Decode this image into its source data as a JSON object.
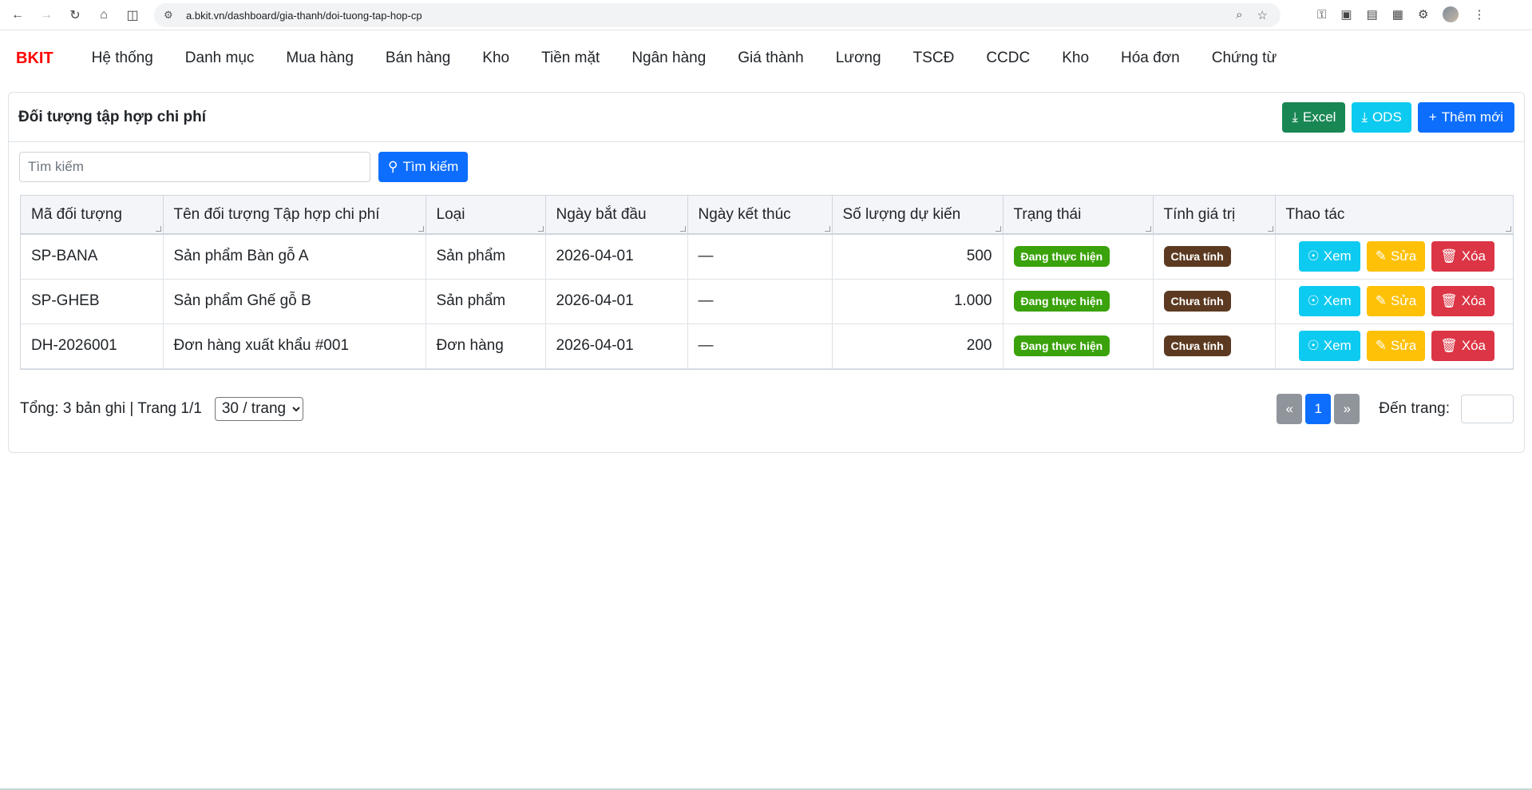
{
  "browser": {
    "url": "a.bkit.vn/dashboard/gia-thanh/doi-tuong-tap-hop-cp"
  },
  "nav": {
    "brand": "BKIT",
    "items": [
      "Hệ thống",
      "Danh mục",
      "Mua hàng",
      "Bán hàng",
      "Kho",
      "Tiền mặt",
      "Ngân hàng",
      "Giá thành",
      "Lương",
      "TSCĐ",
      "CCDC",
      "Kho",
      "Hóa đơn",
      "Chứng từ"
    ]
  },
  "page": {
    "title": "Đối tượng tập hợp chi phí",
    "excel_label": "Excel",
    "ods_label": "ODS",
    "add_label": "Thêm mới",
    "search_placeholder": "Tìm kiếm",
    "search_button": "Tìm kiếm"
  },
  "table": {
    "columns": [
      "Mã đối tượng",
      "Tên đối tượng Tập hợp chi phí",
      "Loại",
      "Ngày bắt đầu",
      "Ngày kết thúc",
      "Số lượng dự kiến",
      "Trạng thái",
      "Tính giá trị",
      "Thao tác"
    ],
    "rows": [
      {
        "code": "SP-BANA",
        "name": "Sản phẩm Bàn gỗ A",
        "type": "Sản phẩm",
        "start": "2026-04-01",
        "end": "—",
        "qty": "500",
        "status": "Đang thực hiện",
        "calc": "Chưa tính"
      },
      {
        "code": "SP-GHEB",
        "name": "Sản phẩm Ghế gỗ B",
        "type": "Sản phẩm",
        "start": "2026-04-01",
        "end": "—",
        "qty": "1.000",
        "status": "Đang thực hiện",
        "calc": "Chưa tính"
      },
      {
        "code": "DH-2026001",
        "name": "Đơn hàng xuất khẩu #001",
        "type": "Đơn hàng",
        "start": "2026-04-01",
        "end": "—",
        "qty": "200",
        "status": "Đang thực hiện",
        "calc": "Chưa tính"
      }
    ],
    "actions": {
      "view": "Xem",
      "edit": "Sửa",
      "delete": "Xóa"
    }
  },
  "footer": {
    "total_text": "Tổng: 3 bản ghi | Trang 1/1",
    "per_page": "30 / trang",
    "prev": "«",
    "page": "1",
    "next": "»",
    "goto_label": "Đến trang:"
  },
  "colors": {
    "brand": "#ff0000",
    "primary": "#0d6efd",
    "success": "#198754",
    "info": "#0dcaf0",
    "warning": "#ffc107",
    "danger": "#dc3545",
    "status_green": "#3aa20a",
    "calc_brown": "#5c3a21"
  }
}
